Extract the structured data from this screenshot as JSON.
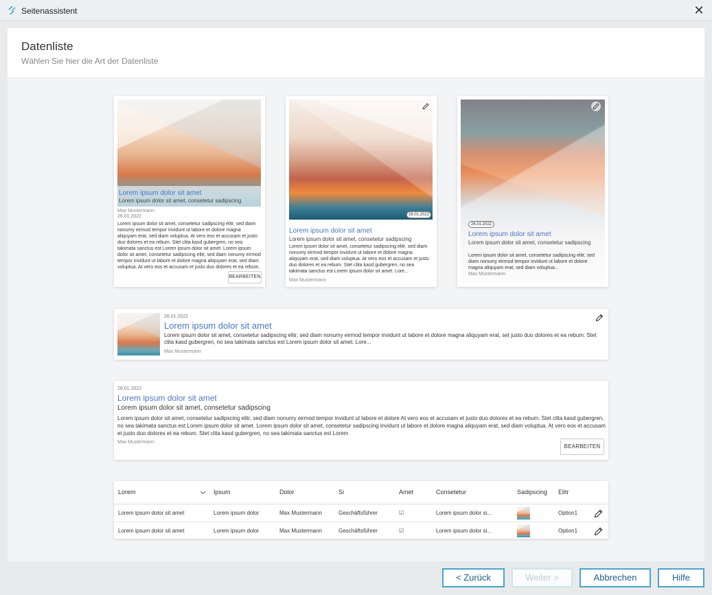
{
  "window": {
    "title": "Seitenassistent",
    "close_symbol": "✕",
    "app_icon": "app-logo-icon"
  },
  "wizard": {
    "title": "Datenliste",
    "subtitle": "Wählen Sie hier die Art der Datenliste"
  },
  "cards": {
    "c1": {
      "title": "Lorem ipsum dolor sit amet",
      "subtitle": "Lorem ipsum dolor sit amet, consetetur sadipscing",
      "author": "Max Mustermann",
      "date": "26.01.2022",
      "body": "Lorem ipsum dolor sit amet, consetetur sadipscing elitr, sed diam nonumy eirmod tempor invidunt ut labore et dolore magna aliquyam erat, sed diam voluptua. At vero eos et accusam et justo duo dolores et ea rebum. Stet clita kasd gubergren, no sea takimata sanctus est Lorem ipsum dolor sit amet. Lorem ipsum dolor sit amet, consetetur sadipscing elitr, sed diam nonumy eirmod tempor invidunt ut labore et dolore magna aliquyam erat, sed diam voluptua. At vero eos et accusam et justo duo dolores et ea rebum. Stet clita kasd gubergren, no sea takimata sanctus est Lorem ipsum dolor sit amet.",
      "button": "BEARBEITEN"
    },
    "c2": {
      "date": "26.01.2022",
      "title": "Lorem ipsum dolor sit amet",
      "subtitle": "Lorem ipsum dolor sit amet, consetetur sadipscing",
      "body": "Lorem ipsum dolor sit amet, consetetur sadipscing elitr, sed diam nonumy eirmod tempor invidunt ut labore et dolore magna aliquyam erat, sed diam voluptua. At vero eos et accusam et justo duo dolores et ea rebum. Stet clita kasd gubergren, no sea takimata sanctus est Lorem ipsum dolor sit amet. Lore...",
      "author": "Max Mustermann"
    },
    "c3": {
      "date": "26.01.2022",
      "title": "Lorem ipsum dolor sit amet",
      "subtitle": "Lorem ipsum dolor sit amet, consetetur sadipscing",
      "body": "Lorem ipsum dolor sit amet, consetetur sadipscing elitr, sed diam nonumy eirmod tempor invidunt ut labore et dolore magna aliquyam erat, sed diam voluptua...",
      "author": "Max Mustermann"
    },
    "c4": {
      "date": "26.01.2022",
      "title": "Lorem ipsum dolor sit amet",
      "body": "Lorem ipsum dolor sit amet, consetetur sadipscing elitr, sed diam nonumy eirmod tempor invidunt ut labore et dolore magna aliquyam erat, set justo duo dolores et ea rebum. Stet clita kasd gubergren, no sea takimata sanctus est Lorem ipsum dolor sit amet. Lore...",
      "author": "Max Mustermann"
    },
    "c5": {
      "date": "26.01.2022",
      "title": "Lorem ipsum dolor sit amet",
      "subtitle": "Lorem ipsum dolor sit amet, consetetur sadipscing",
      "body": "Lorem ipsum dolor sit amet, consetetur sadipscing elitr, sed diam nonumy eirmod tempor invidunt ut labore et dolore  At vero eos et accusam et justo duo dolores et ea rebum. Stet clita kasd gubergren, no sea takimata sanctus est Lorem ipsum dolor sit amet. Lorem ipsum dolor sit amet, consetetur sadipscing  invidunt ut labore et dolore magna aliquyam erat, sed diam voluptua. At vero eos et accusam et justo duo dolores et ea rebum. Stet clita kasd gubergren, no sea takimata sanctus est Lorem",
      "author": "Max Mustermann",
      "button": "BEARBEITEN"
    }
  },
  "table": {
    "headers": [
      "Lorem",
      "Ipsum",
      "Dolor",
      "Si",
      "Amet",
      "Consetetur",
      "Sadipscing",
      "Elitr"
    ],
    "rows": [
      [
        "Lorem ipsum dolor sit amet",
        "Lorem ipsum dolor",
        "Max Mustermann",
        "Geschäftsführer",
        "☑",
        "Lorem ipsum dolor si...",
        "",
        "Option1"
      ],
      [
        "Lorem ipsum dolor sit amet",
        "Lorem ipsum dolor",
        "Max Mustermann",
        "Geschäftsführer",
        "☑",
        "Lorem ipsum dolor si...",
        "",
        "Option1"
      ]
    ]
  },
  "footer": {
    "back": "< Zurück",
    "next": "Weiter >",
    "cancel": "Abbrechen",
    "help": "Hilfe"
  },
  "colors": {
    "accent": "#4ba3c7",
    "link": "#4b76c4",
    "disabled": "#bfcdd5"
  }
}
